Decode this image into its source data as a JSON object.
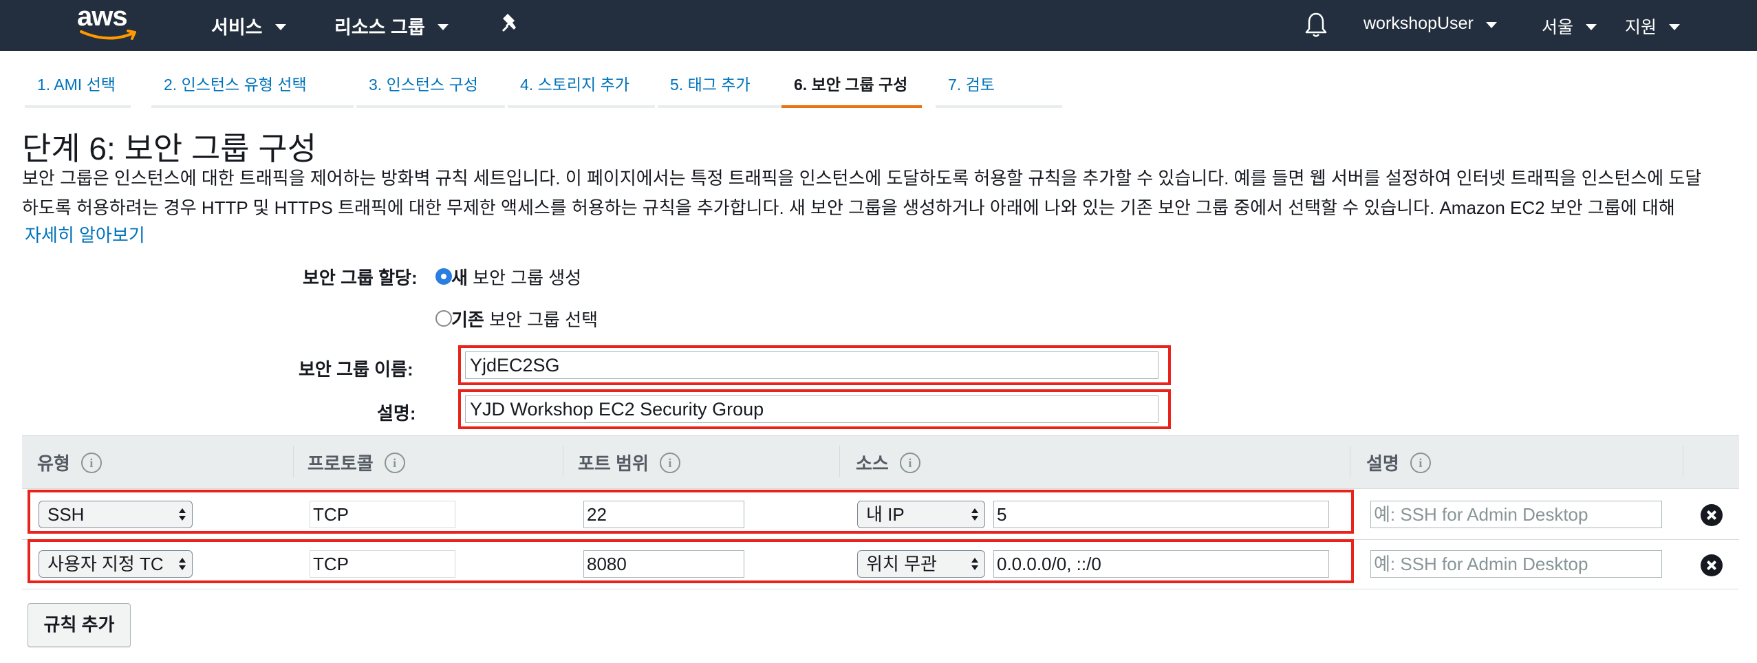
{
  "nav": {
    "logo": "aws",
    "services": "서비스",
    "resource_groups": "리소스 그룹",
    "user": "workshopUser",
    "region": "서울",
    "support": "지원"
  },
  "wizard_tabs": [
    {
      "label": "1. AMI 선택",
      "active": false
    },
    {
      "label": "2. 인스턴스 유형 선택",
      "active": false
    },
    {
      "label": "3. 인스턴스 구성",
      "active": false
    },
    {
      "label": "4. 스토리지 추가",
      "active": false
    },
    {
      "label": "5. 태그 추가",
      "active": false
    },
    {
      "label": "6. 보안 그룹 구성",
      "active": true
    },
    {
      "label": "7. 검토",
      "active": false
    }
  ],
  "page": {
    "title": "단계 6: 보안 그룹 구성",
    "description_line1": "보안 그룹은 인스턴스에 대한 트래픽을 제어하는 방화벽 규칙 세트입니다. 이 페이지에서는 특정 트래픽을 인스턴스에 도달하도록 허용할 규칙을 추가할 수 있습니다. 예를 들면 웹 서버를 설정하여 인터넷 트래픽을 인스턴스에 도달",
    "description_line2": "하도록 허용하려는 경우 HTTP 및 HTTPS 트래픽에 대한 무제한 액세스를 허용하는 규칙을 추가합니다. 새 보안 그룹을 생성하거나 아래에 나와 있는 기존 보안 그룹 중에서 선택할 수 있습니다. Amazon EC2 보안 그룹에 대해",
    "learn_more": "자세히 알아보기"
  },
  "form": {
    "assign_label": "보안 그룹 할당:",
    "option_new_bold": "새",
    "option_new_rest": " 보안 그룹 생성",
    "option_existing_bold": "기존",
    "option_existing_rest": " 보안 그룹 선택",
    "selected_option": "new",
    "name_label": "보안 그룹 이름:",
    "name_value": "YjdEC2SG",
    "desc_label": "설명:",
    "desc_value": "YJD Workshop EC2 Security Group"
  },
  "rules_table": {
    "headers": [
      "유형",
      "프로토콜",
      "포트 범위",
      "소스",
      "설명"
    ],
    "rows": [
      {
        "type": "SSH",
        "protocol": "TCP",
        "port": "22",
        "source_select": "내 IP",
        "source_value": "5",
        "description_placeholder": "예: SSH for Admin Desktop"
      },
      {
        "type": "사용자 지정 TC",
        "protocol": "TCP",
        "port": "8080",
        "source_select": "위치 무관",
        "source_value": "0.0.0.0/0, ::/0",
        "description_placeholder": "예: SSH for Admin Desktop"
      }
    ],
    "add_rule_label": "규칙 추가"
  },
  "colors": {
    "nav_bg": "#232f3e",
    "link": "#0073bb",
    "active_tab_underline": "#ec7211",
    "highlight_box": "#e8231b",
    "radio_selected": "#2a7de1"
  }
}
